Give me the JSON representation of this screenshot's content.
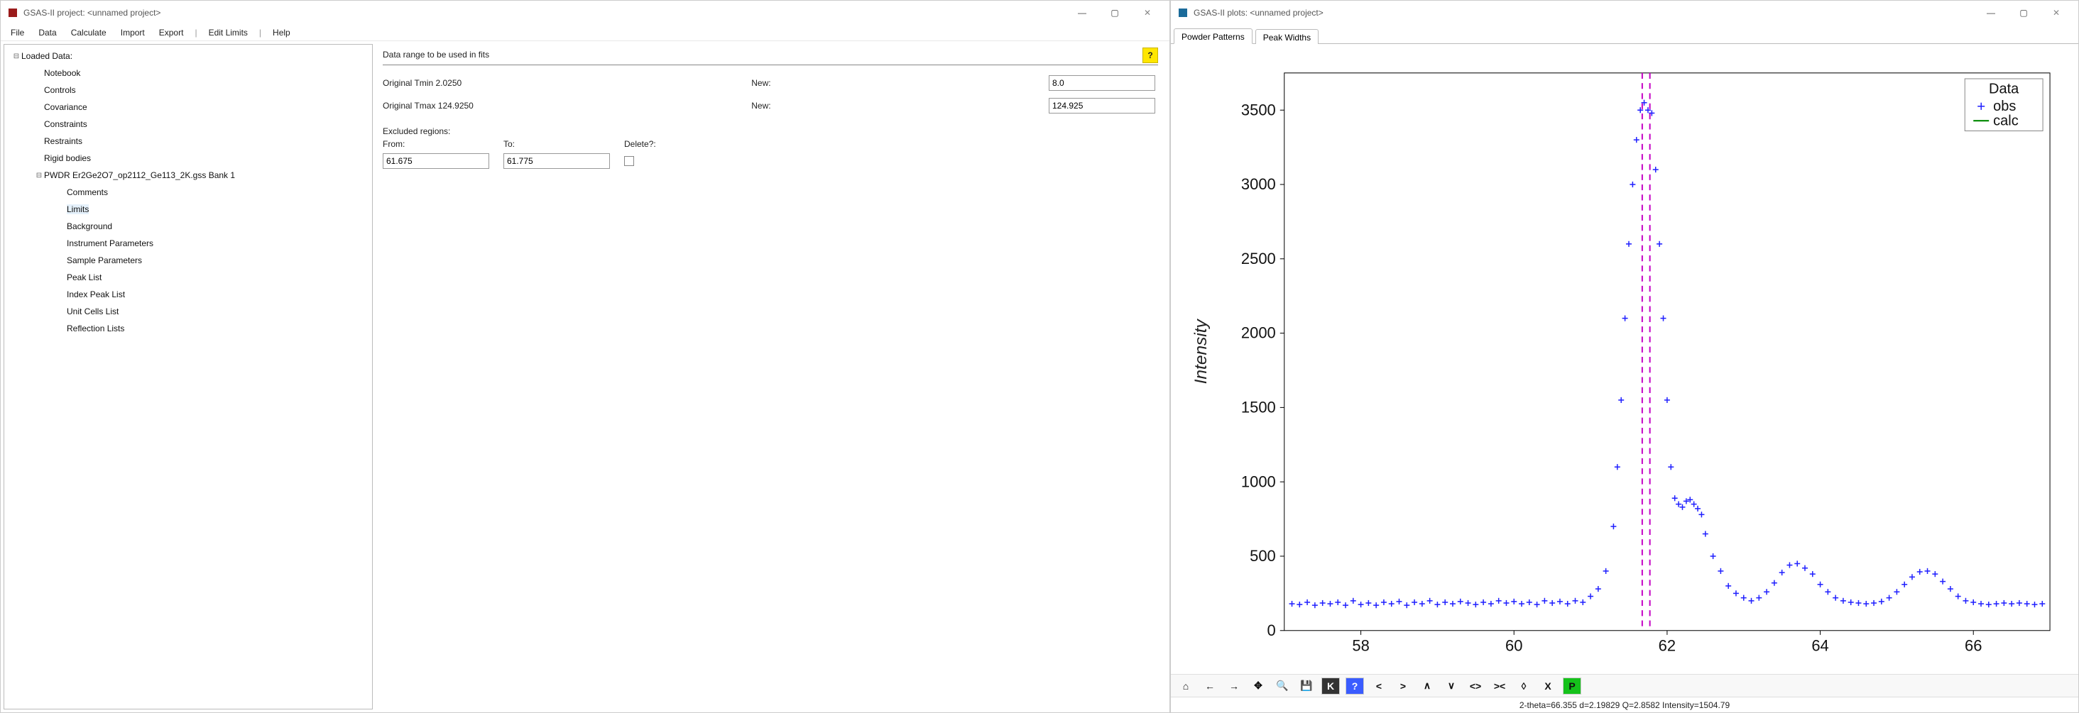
{
  "left_window": {
    "title": "GSAS-II project: <unnamed project>",
    "menus": [
      "File",
      "Data",
      "Calculate",
      "Import",
      "Export",
      "|",
      "Edit Limits",
      "|",
      "Help"
    ],
    "tree": [
      {
        "label": "Loaded Data:",
        "depth": 0,
        "toggle": "-"
      },
      {
        "label": "Notebook",
        "depth": 1
      },
      {
        "label": "Controls",
        "depth": 1
      },
      {
        "label": "Covariance",
        "depth": 1
      },
      {
        "label": "Constraints",
        "depth": 1
      },
      {
        "label": "Restraints",
        "depth": 1
      },
      {
        "label": "Rigid bodies",
        "depth": 1
      },
      {
        "label": "PWDR Er2Ge2O7_op2112_Ge113_2K.gss Bank 1",
        "depth": 1,
        "toggle": "-"
      },
      {
        "label": "Comments",
        "depth": 2
      },
      {
        "label": "Limits",
        "depth": 2,
        "selected": true
      },
      {
        "label": "Background",
        "depth": 2
      },
      {
        "label": "Instrument Parameters",
        "depth": 2
      },
      {
        "label": "Sample Parameters",
        "depth": 2
      },
      {
        "label": "Peak List",
        "depth": 2
      },
      {
        "label": "Index Peak List",
        "depth": 2
      },
      {
        "label": "Unit Cells List",
        "depth": 2
      },
      {
        "label": "Reflection Lists",
        "depth": 2
      }
    ],
    "content": {
      "title": "Data range to be used in fits",
      "tmin_label": "Original Tmin 2.0250",
      "tmax_label": "Original Tmax 124.9250",
      "new_label": "New:",
      "tmin_value": "8.0",
      "tmax_value": "124.925",
      "excl_title": "Excluded regions:",
      "from_label": "From:",
      "to_label": "To:",
      "delete_label": "Delete?:",
      "from_value": "61.675",
      "to_value": "61.775"
    }
  },
  "right_window": {
    "title": "GSAS-II plots: <unnamed project>",
    "tabs": [
      "Powder Patterns",
      "Peak Widths"
    ],
    "status": "2-theta=66.355 d=2.19829 Q=2.8582 Intensity=1504.79",
    "legend": {
      "title": "Data",
      "obs": "obs",
      "calc": "calc"
    },
    "toolbar_icons": [
      "home-icon",
      "back-icon",
      "forward-icon",
      "pan-icon",
      "zoom-icon",
      "save-icon",
      "key-icon",
      "help-icon",
      "lt-icon",
      "gt-icon",
      "caret-icon",
      "vee-icon",
      "fit-h-icon",
      "fit-compress-icon",
      "diamond-icon",
      "x-icon",
      "publish-icon"
    ]
  },
  "chart_data": {
    "type": "scatter",
    "title": "",
    "xlabel": "",
    "ylabel": "Intensity",
    "xlim": [
      57,
      67
    ],
    "ylim": [
      0,
      3750
    ],
    "xticks": [
      58,
      60,
      62,
      64,
      66
    ],
    "yticks": [
      0,
      500,
      1000,
      1500,
      2000,
      2500,
      3000,
      3500
    ],
    "vlines": [
      61.675,
      61.775
    ],
    "vline_color": "#c400c4",
    "series": [
      {
        "name": "obs",
        "marker": "+",
        "color": "#2020ff",
        "x": [
          57.1,
          57.2,
          57.3,
          57.4,
          57.5,
          57.6,
          57.7,
          57.8,
          57.9,
          58.0,
          58.1,
          58.2,
          58.3,
          58.4,
          58.5,
          58.6,
          58.7,
          58.8,
          58.9,
          59.0,
          59.1,
          59.2,
          59.3,
          59.4,
          59.5,
          59.6,
          59.7,
          59.8,
          59.9,
          60.0,
          60.1,
          60.2,
          60.3,
          60.4,
          60.5,
          60.6,
          60.7,
          60.8,
          60.9,
          61.0,
          61.1,
          61.2,
          61.3,
          61.35,
          61.4,
          61.45,
          61.5,
          61.55,
          61.6,
          61.65,
          61.7,
          61.75,
          61.8,
          61.85,
          61.9,
          61.95,
          62.0,
          62.05,
          62.1,
          62.15,
          62.2,
          62.25,
          62.3,
          62.35,
          62.4,
          62.45,
          62.5,
          62.6,
          62.7,
          62.8,
          62.9,
          63.0,
          63.1,
          63.2,
          63.3,
          63.4,
          63.5,
          63.6,
          63.7,
          63.8,
          63.9,
          64.0,
          64.1,
          64.2,
          64.3,
          64.4,
          64.5,
          64.6,
          64.7,
          64.8,
          64.9,
          65.0,
          65.1,
          65.2,
          65.3,
          65.4,
          65.5,
          65.6,
          65.7,
          65.8,
          65.9,
          66.0,
          66.1,
          66.2,
          66.3,
          66.4,
          66.5,
          66.6,
          66.7,
          66.8,
          66.9
        ],
        "y": [
          180,
          175,
          190,
          170,
          185,
          180,
          190,
          170,
          200,
          175,
          185,
          170,
          190,
          180,
          195,
          170,
          190,
          180,
          200,
          175,
          190,
          180,
          195,
          185,
          175,
          190,
          180,
          200,
          185,
          195,
          180,
          190,
          175,
          200,
          185,
          195,
          180,
          200,
          190,
          230,
          280,
          400,
          700,
          1100,
          1550,
          2100,
          2600,
          3000,
          3300,
          3500,
          3550,
          3500,
          3480,
          3100,
          2600,
          2100,
          1550,
          1100,
          890,
          850,
          830,
          870,
          880,
          850,
          820,
          780,
          650,
          500,
          400,
          300,
          250,
          220,
          200,
          220,
          260,
          320,
          390,
          440,
          450,
          420,
          380,
          310,
          260,
          220,
          200,
          190,
          185,
          180,
          185,
          195,
          220,
          260,
          310,
          360,
          395,
          400,
          380,
          330,
          280,
          230,
          200,
          190,
          180,
          175,
          180,
          185,
          180,
          185,
          180,
          175,
          180
        ]
      },
      {
        "name": "calc",
        "marker": "line",
        "color": "#008800",
        "x": [],
        "y": []
      }
    ]
  }
}
